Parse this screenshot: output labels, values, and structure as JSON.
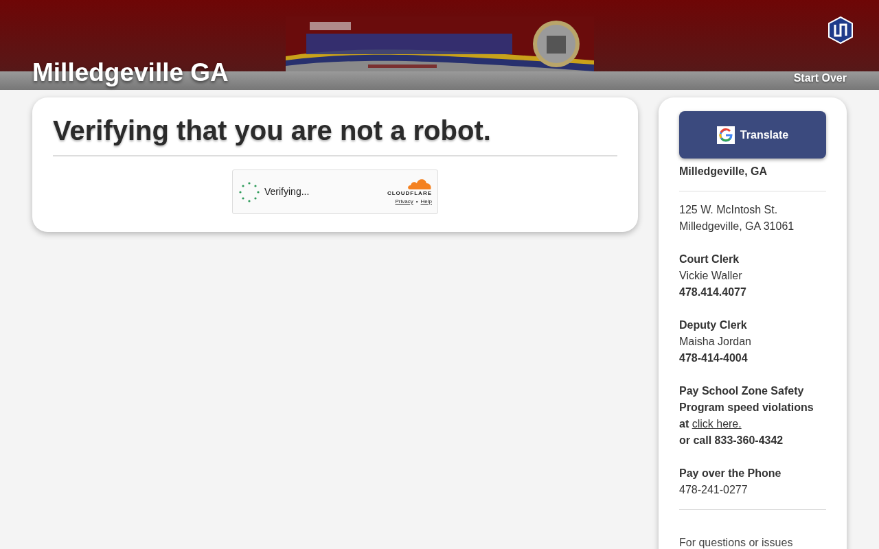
{
  "header": {
    "title": "Milledgeville GA",
    "start_over": "Start Over"
  },
  "main_card": {
    "heading": "Verifying that you are not a robot.",
    "widget": {
      "status": "Verifying...",
      "brand": "CLOUDFLARE",
      "links": [
        "Privacy",
        "Help"
      ],
      "separator": "•"
    }
  },
  "sidebar": {
    "translate_button": "Translate",
    "org": "Milledgeville, GA",
    "address": [
      "125 W. McIntosh St.",
      "Milledgeville, GA 31061"
    ],
    "contacts": [
      {
        "role": "Court Clerk",
        "name": "Vickie Waller",
        "phone": "478.414.4077"
      },
      {
        "role": "Deputy Clerk",
        "name": "Maisha Jordan",
        "phone": "478-414-4004"
      }
    ],
    "pay_online": {
      "text": "Pay School Zone Safety Program speed violations at",
      "link": "click here.",
      "call": "or call 833-360-4342"
    },
    "pay_phone": {
      "label": "Pay over the Phone",
      "phone": "478-241-0277"
    },
    "footer": "For questions or issues"
  }
}
